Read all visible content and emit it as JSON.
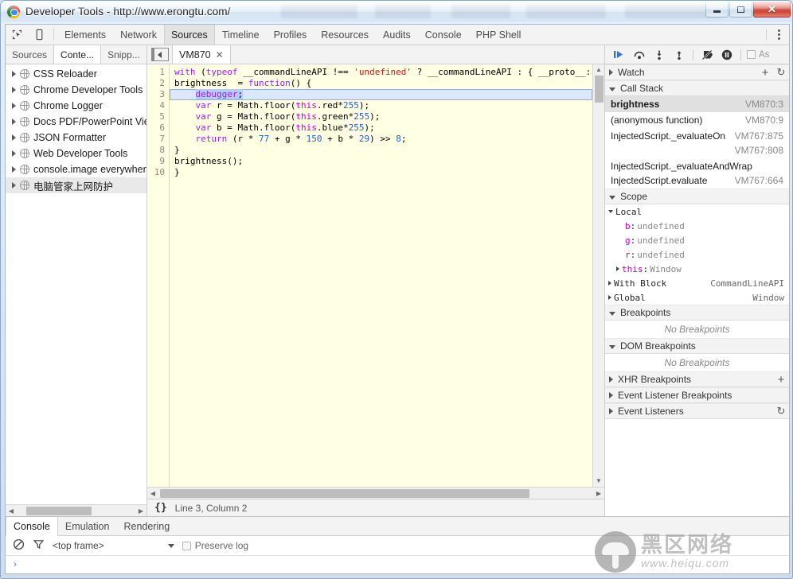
{
  "window": {
    "title": "Developer Tools - http://www.erongtu.com/",
    "controls": {
      "minimize": "minimize-button",
      "maximize": "maximize-button",
      "close": "✕"
    }
  },
  "toolbar": {
    "inspect_icon": "inspect-element-icon",
    "device_icon": "device-mode-icon",
    "tabs": [
      {
        "label": "Elements",
        "active": false
      },
      {
        "label": "Network",
        "active": false
      },
      {
        "label": "Sources",
        "active": true
      },
      {
        "label": "Timeline",
        "active": false
      },
      {
        "label": "Profiles",
        "active": false
      },
      {
        "label": "Resources",
        "active": false
      },
      {
        "label": "Audits",
        "active": false
      },
      {
        "label": "Console",
        "active": false
      },
      {
        "label": "PHP Shell",
        "active": false
      }
    ],
    "menu_icon": "kebab-menu-icon"
  },
  "navigator": {
    "tabs": [
      {
        "label": "Sources",
        "active": false
      },
      {
        "label": "Conte...",
        "active": true
      },
      {
        "label": "Snipp...",
        "active": false
      }
    ],
    "items": [
      {
        "label": "CSS Reloader",
        "selected": false
      },
      {
        "label": "Chrome Developer Tools",
        "selected": false
      },
      {
        "label": "Chrome Logger",
        "selected": false
      },
      {
        "label": "Docs PDF/PowerPoint Vie",
        "selected": false
      },
      {
        "label": "JSON Formatter",
        "selected": false
      },
      {
        "label": "Web Developer Tools",
        "selected": false
      },
      {
        "label": "console.image everywher",
        "selected": false
      },
      {
        "label": "电脑管家上网防护",
        "selected": true
      }
    ]
  },
  "editor": {
    "nav_toggle_icon": "toggle-navigator-icon",
    "tab": {
      "label": "VM870",
      "close": "✕"
    },
    "line_numbers": [
      "1",
      "2",
      "3",
      "4",
      "5",
      "6",
      "7",
      "8",
      "9",
      "10"
    ],
    "status": {
      "braces": "{}",
      "position": "Line 3, Column 2"
    }
  },
  "debugger_toolbar": {
    "resume_icon": "resume-script-execution-icon",
    "step_over_icon": "step-over-icon",
    "step_into_icon": "step-into-icon",
    "step_out_icon": "step-out-icon",
    "deactivate_breakpoints_icon": "deactivate-breakpoints-icon",
    "pause_on_exceptions_icon": "pause-on-exceptions-icon",
    "async_label": "As"
  },
  "sidebar": {
    "watch": {
      "title": "Watch",
      "add": "+",
      "refresh": "↻"
    },
    "call_stack": {
      "title": "Call Stack",
      "frames": [
        {
          "fn": "brightness",
          "loc": "VM870:3",
          "active": true,
          "wrap": false
        },
        {
          "fn": "(anonymous function)",
          "loc": "VM870:9",
          "active": false,
          "wrap": false
        },
        {
          "fn": "InjectedScript._evaluateOn",
          "loc": "VM767:875",
          "active": false,
          "wrap": false
        },
        {
          "fn": "InjectedScript._evaluateAndWrap",
          "loc": "VM767:808",
          "active": false,
          "wrap": true
        },
        {
          "fn": "InjectedScript.evaluate",
          "loc": "VM767:664",
          "active": false,
          "wrap": false
        }
      ]
    },
    "scope": {
      "title": "Scope",
      "local_label": "Local",
      "locals": [
        {
          "name": "b",
          "value": "undefined"
        },
        {
          "name": "g",
          "value": "undefined"
        },
        {
          "name": "r",
          "value": "undefined"
        }
      ],
      "this_name": "this",
      "this_value": "Window",
      "with_block_label": "With Block",
      "with_block_value": "CommandLineAPI",
      "global_label": "Global",
      "global_value": "Window"
    },
    "breakpoints": {
      "title": "Breakpoints",
      "empty": "No Breakpoints"
    },
    "dom_breakpoints": {
      "title": "DOM Breakpoints",
      "empty": "No Breakpoints"
    },
    "xhr_breakpoints": {
      "title": "XHR Breakpoints",
      "add": "+"
    },
    "event_listener_breakpoints": {
      "title": "Event Listener Breakpoints"
    },
    "event_listeners": {
      "title": "Event Listeners",
      "refresh": "↻"
    }
  },
  "drawer": {
    "tabs": [
      {
        "label": "Console",
        "active": true
      },
      {
        "label": "Emulation",
        "active": false
      },
      {
        "label": "Rendering",
        "active": false
      }
    ],
    "clear_icon": "clear-console-icon",
    "filter_icon": "filter-icon",
    "frame_value": "<top frame>",
    "preserve_log_label": "Preserve log",
    "prompt": "›"
  },
  "watermark": {
    "cn": "黑区网络",
    "url": "www.heiqu.com"
  },
  "code_lines": [
    {
      "n": 1,
      "html": "<span class=\"kw\">with</span> (<span class=\"kw\">typeof</span> __commandLineAPI !== <span class=\"str\">'undefined'</span> ? __commandLineAPI : { __proto__: n"
    },
    {
      "n": 2,
      "html": "brightness  = <span class=\"kw\">function</span>() {"
    },
    {
      "n": 3,
      "html": "    <span class=\"sel\"><span class=\"kw\">debugger</span>;</span>",
      "exec": true
    },
    {
      "n": 4,
      "html": "    <span class=\"kw\">var</span> r = Math.floor(<span class=\"ths\">this</span>.red*<span class=\"num\">255</span>);"
    },
    {
      "n": 5,
      "html": "    <span class=\"kw\">var</span> g = Math.floor(<span class=\"ths\">this</span>.green*<span class=\"num\">255</span>);"
    },
    {
      "n": 6,
      "html": "    <span class=\"kw\">var</span> b = Math.floor(<span class=\"ths\">this</span>.blue*<span class=\"num\">255</span>);"
    },
    {
      "n": 7,
      "html": "    <span class=\"kw\">return</span> (r * <span class=\"num\">77</span> + g * <span class=\"num\">150</span> + b * <span class=\"num\">29</span>) >> <span class=\"num\">8</span>;"
    },
    {
      "n": 8,
      "html": "}"
    },
    {
      "n": 9,
      "html": "brightness();"
    },
    {
      "n": 10,
      "html": "}"
    }
  ]
}
